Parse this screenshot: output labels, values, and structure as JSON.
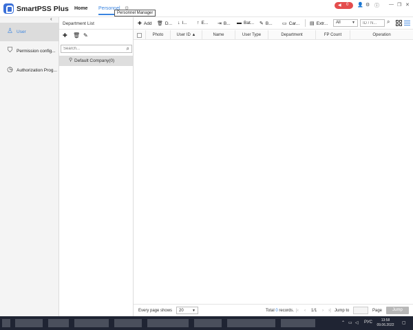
{
  "app": {
    "title": "SmartPSS Plus",
    "nav_home": "Home",
    "nav_personnel": "Personnel",
    "tooltip": "Personnel Manager",
    "alarm_count": "0",
    "accent_color": "#3a84e0",
    "alarm_color": "#e44d4d"
  },
  "sidebar": {
    "items": [
      {
        "label": "User",
        "icon": "user-icon",
        "active": true
      },
      {
        "label": "Permission config...",
        "icon": "shield-icon",
        "active": false
      },
      {
        "label": "Authorization Prog...",
        "icon": "clock-icon",
        "active": false
      }
    ]
  },
  "department": {
    "title": "Department List",
    "search_placeholder": "Search...",
    "root_node": "Default Company(0)"
  },
  "toolbar": {
    "add": "Add",
    "delete": "D...",
    "import": "I...",
    "export": "E...",
    "b": "B...",
    "batch": "Bat...",
    "b2": "B...",
    "card": "Car...",
    "extract": "Extr...",
    "filter_value": "All",
    "id_placeholder": "ID / N..."
  },
  "table": {
    "columns": [
      "Photo",
      "User ID",
      "Name",
      "User Type",
      "Department",
      "FP Count",
      "Operation"
    ],
    "rows": []
  },
  "footer": {
    "per_page_label": "Every page shows",
    "per_page_value": "20",
    "total_prefix": "Total",
    "total_count": "0",
    "total_suffix": "records.",
    "page_indicator": "1/1",
    "jump_to_label": "Jump to",
    "page_label": "Page",
    "jump_button": "Jump"
  },
  "taskbar": {
    "lang": "РУС",
    "time": "13:58",
    "date": "09.06.2022"
  }
}
